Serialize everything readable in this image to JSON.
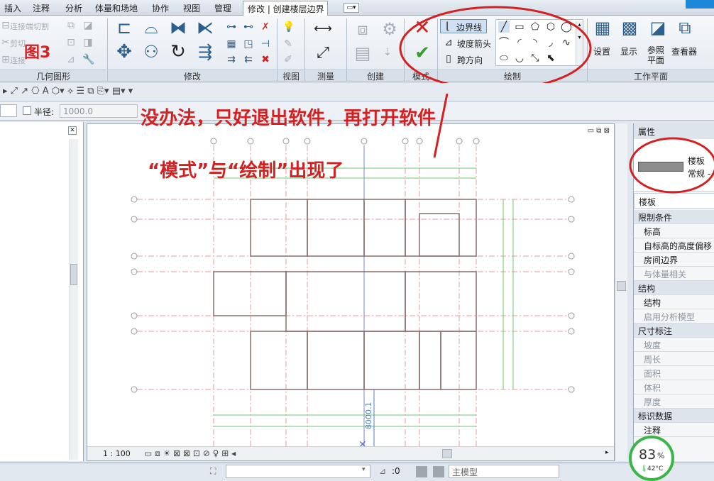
{
  "tabs": [
    "插入",
    "注释",
    "分析",
    "体量和场地",
    "协作",
    "视图",
    "管理",
    "修改 | 创建楼层边界"
  ],
  "ribbon": {
    "geometry_items": [
      "连接端切割",
      "剪切",
      "连接"
    ],
    "panel_geometry": "几何图形",
    "panel_modify": "修改",
    "panel_view": "视图",
    "panel_measure": "测量",
    "panel_create": "创建",
    "panel_mode": "模式",
    "panel_draw": "绘制",
    "panel_workplane": "工作平面",
    "draw_boundary": "边界线",
    "draw_slope": "坡度箭头",
    "draw_span": "跨方向",
    "wp_set": "设置",
    "wp_show": "显示",
    "wp_ref": "参照\n平面",
    "wp_viewer": "查看器"
  },
  "options_bar": {
    "radius_label": "半径:",
    "radius_value": "1000.0"
  },
  "annotations": {
    "fig_label": "图3",
    "line1": "没办法，只好退出软件，再打开软件",
    "line2": "“模式”与“绘制”出现了"
  },
  "properties": {
    "header": "属性",
    "type_name": "楼板",
    "type_sub": "常规 -",
    "category": "楼板",
    "rows": [
      {
        "t": "cat",
        "label": "限制条件"
      },
      {
        "t": "item",
        "label": "标高"
      },
      {
        "t": "item",
        "label": "自标高的高度偏移"
      },
      {
        "t": "item",
        "label": "房间边界"
      },
      {
        "t": "dim",
        "label": "与体量相关"
      },
      {
        "t": "cat",
        "label": "结构"
      },
      {
        "t": "item",
        "label": "结构"
      },
      {
        "t": "dim",
        "label": "启用分析模型"
      },
      {
        "t": "cat",
        "label": "尺寸标注"
      },
      {
        "t": "dim",
        "label": "坡度"
      },
      {
        "t": "dim",
        "label": "周长"
      },
      {
        "t": "dim",
        "label": "面积"
      },
      {
        "t": "dim",
        "label": "体积"
      },
      {
        "t": "dim",
        "label": "厚度"
      },
      {
        "t": "cat",
        "label": "标识数据"
      },
      {
        "t": "item",
        "label": "注释"
      }
    ]
  },
  "canvas": {
    "scale": "1 : 100",
    "dimension_text": "8000.1"
  },
  "status": {
    "zero": ":0",
    "model": "主模型"
  },
  "gauge": {
    "value": "83",
    "unit": "%",
    "temp": "42°C"
  },
  "colors": {
    "annotation_red": "#d42020",
    "gauge_green": "#3bb54a"
  }
}
